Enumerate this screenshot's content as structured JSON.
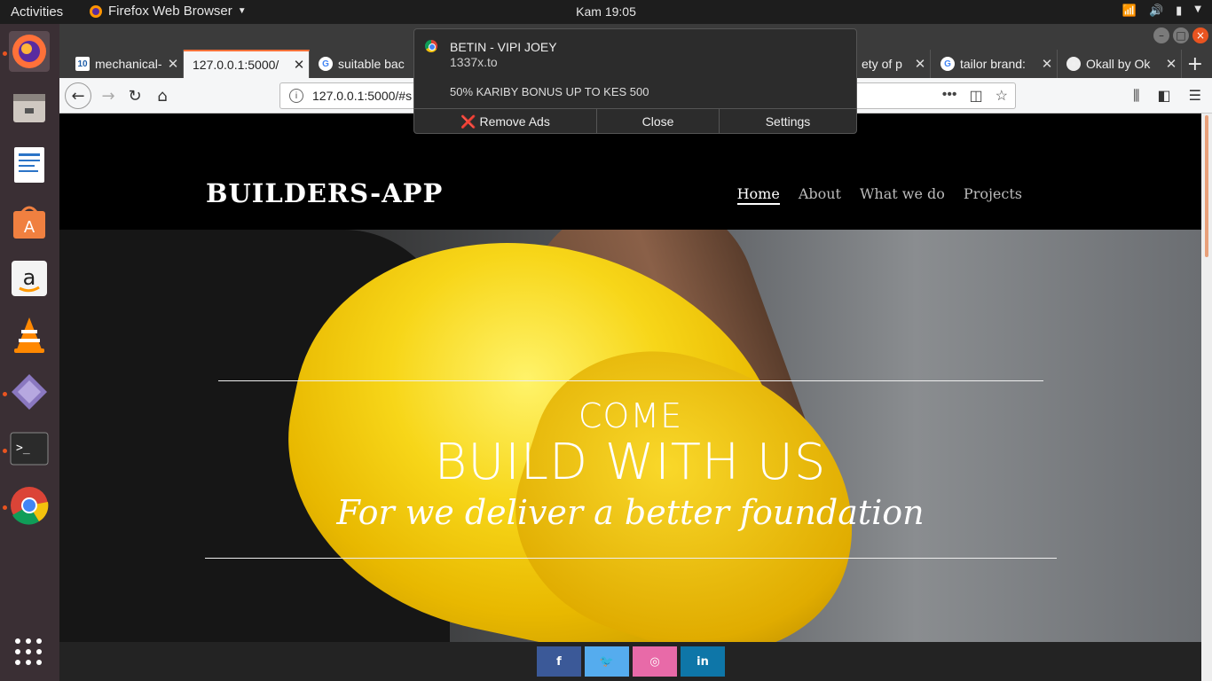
{
  "topbar": {
    "activities": "Activities",
    "app_name": "Firefox Web Browser",
    "clock": "Kam 19:05"
  },
  "dock": {
    "items": [
      "firefox-icon",
      "files-icon",
      "writer-icon",
      "software-icon",
      "amazon-icon",
      "vlc-icon",
      "editor-icon",
      "terminal-icon",
      "chrome-icon",
      "apps-grid-icon"
    ]
  },
  "tabs": [
    {
      "title": "mechanical-",
      "favicon": "10",
      "active": false
    },
    {
      "title": "127.0.0.1:5000/",
      "favicon": "",
      "active": true
    },
    {
      "title": "suitable bac",
      "favicon": "G",
      "active": false
    },
    {
      "title": "ety of p",
      "favicon": "",
      "active": false
    },
    {
      "title": "tailor brand:",
      "favicon": "G",
      "active": false
    },
    {
      "title": "Okall by Ok",
      "favicon": "",
      "active": false
    }
  ],
  "navbar": {
    "url": "127.0.0.1:5000/#s"
  },
  "notification": {
    "title": "BETIN  - VIPI JOEY",
    "source": "1337x.to",
    "body": "50% KARIBY BONUS UP TO KES 500",
    "remove_ads": "❌ Remove Ads",
    "close": "Close",
    "settings": "Settings"
  },
  "site": {
    "brand": "BUILDERS-APP",
    "nav": [
      "Home",
      "About",
      "What we do",
      "Projects"
    ],
    "hero": {
      "come": "COME",
      "build": "BUILD WITH US",
      "tagline": "For we deliver a better foundation"
    },
    "social": [
      {
        "label": "f",
        "color": "#3b5998"
      },
      {
        "label": "🐦",
        "color": "#55acee"
      },
      {
        "label": "◎",
        "color": "#e86aa8"
      },
      {
        "label": "in",
        "color": "#0e76a8"
      }
    ]
  },
  "colors": {
    "accent": "#ff7139",
    "ubuntu_orange": "#e95420"
  }
}
